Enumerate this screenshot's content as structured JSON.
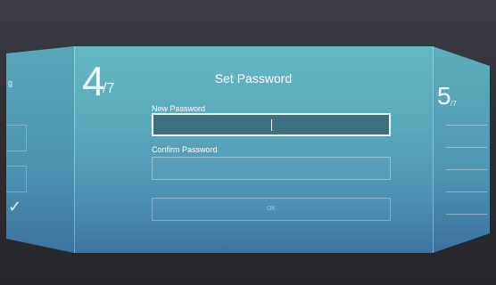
{
  "wizard": {
    "current_step": "4",
    "total_steps": "/7",
    "next_step": "5",
    "next_step_sub": "/7"
  },
  "dialog": {
    "title": "Set Password",
    "new_password_label": "New Password",
    "confirm_password_label": "Confirm Password",
    "new_password_value": "",
    "confirm_password_value": "",
    "ok_label": "OK"
  },
  "left_wing": {
    "fragment_label": "g"
  },
  "colors": {
    "panel_top": "#63b8c1",
    "panel_bottom": "#3e74a3",
    "active_field_border": "#eaf9fb"
  }
}
